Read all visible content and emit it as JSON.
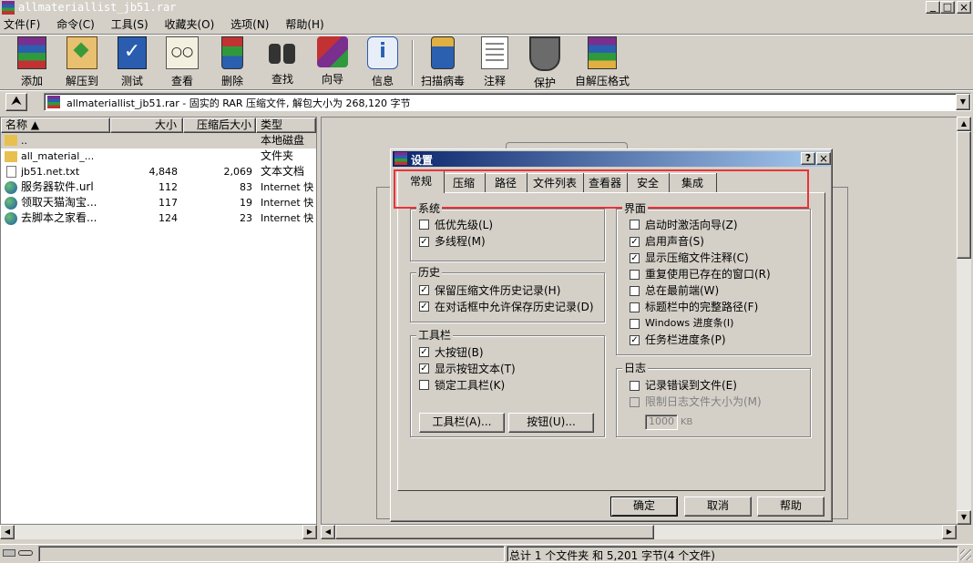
{
  "window": {
    "title": "allmateriallist_jb51.rar"
  },
  "menu": [
    "文件(F)",
    "命令(C)",
    "工具(S)",
    "收藏夹(O)",
    "选项(N)",
    "帮助(H)"
  ],
  "toolbar": [
    {
      "label": "添加",
      "icon": "add-icon"
    },
    {
      "label": "解压到",
      "icon": "extract-icon"
    },
    {
      "label": "测试",
      "icon": "test-icon"
    },
    {
      "label": "查看",
      "icon": "view-icon"
    },
    {
      "label": "删除",
      "icon": "delete-icon"
    },
    {
      "label": "查找",
      "icon": "find-icon"
    },
    {
      "label": "向导",
      "icon": "wizard-icon"
    },
    {
      "label": "信息",
      "icon": "info-icon"
    },
    {
      "label": "扫描病毒",
      "icon": "virus-scan-icon"
    },
    {
      "label": "注释",
      "icon": "comment-icon"
    },
    {
      "label": "保护",
      "icon": "protect-icon"
    },
    {
      "label": "自解压格式",
      "icon": "sfx-icon"
    }
  ],
  "address": {
    "text": "allmateriallist_jb51.rar - 固实的 RAR 压缩文件, 解包大小为 268,120 字节"
  },
  "filelist": {
    "columns": [
      "名称 ▲",
      "大小",
      "压缩后大小",
      "类型"
    ],
    "rows": [
      {
        "name": "..",
        "size": "",
        "packed": "",
        "type": "本地磁盘",
        "icon": "folder-up-icon"
      },
      {
        "name": "all_material_...",
        "size": "",
        "packed": "",
        "type": "文件夹",
        "icon": "folder-icon"
      },
      {
        "name": "jb51.net.txt",
        "size": "4,848",
        "packed": "2,069",
        "type": "文本文档",
        "icon": "text-file-icon"
      },
      {
        "name": "服务器软件.url",
        "size": "112",
        "packed": "83",
        "type": "Internet 快",
        "icon": "globe-icon"
      },
      {
        "name": "领取天猫淘宝...",
        "size": "117",
        "packed": "19",
        "type": "Internet 快",
        "icon": "globe-icon"
      },
      {
        "name": "去脚本之家看...",
        "size": "124",
        "packed": "23",
        "type": "Internet 快",
        "icon": "globe-icon"
      }
    ]
  },
  "dialog": {
    "title": "设置",
    "help_q": "?",
    "close": "×",
    "tabs": [
      "常规",
      "压缩",
      "路径",
      "文件列表",
      "查看器",
      "安全",
      "集成"
    ],
    "system": {
      "title": "系统",
      "items": [
        {
          "label": "低优先级(L)",
          "checked": false
        },
        {
          "label": "多线程(M)",
          "checked": true
        }
      ]
    },
    "history": {
      "title": "历史",
      "items": [
        {
          "label": "保留压缩文件历史记录(H)",
          "checked": true
        },
        {
          "label": "在对话框中允许保存历史记录(D)",
          "checked": true
        }
      ]
    },
    "toolbar_group": {
      "title": "工具栏",
      "items": [
        {
          "label": "大按钮(B)",
          "checked": true
        },
        {
          "label": "显示按钮文本(T)",
          "checked": true
        },
        {
          "label": "锁定工具栏(K)",
          "checked": false
        }
      ],
      "btn_toolbar": "工具栏(A)...",
      "btn_buttons": "按钮(U)..."
    },
    "interface": {
      "title": "界面",
      "items": [
        {
          "label": "启动时激活向导(Z)",
          "checked": false
        },
        {
          "label": "启用声音(S)",
          "checked": true
        },
        {
          "label": "显示压缩文件注释(C)",
          "checked": true
        },
        {
          "label": "重复使用已存在的窗口(R)",
          "checked": false
        },
        {
          "label": "总在最前端(W)",
          "checked": false
        },
        {
          "label": "标题栏中的完整路径(F)",
          "checked": false
        },
        {
          "label": "Windows 进度条(I)",
          "checked": false
        },
        {
          "label": "任务栏进度条(P)",
          "checked": true
        }
      ]
    },
    "log": {
      "title": "日志",
      "items": [
        {
          "label": "记录错误到文件(E)",
          "checked": false
        },
        {
          "label": "限制日志文件大小为(M)",
          "checked": false
        }
      ],
      "size_value": "1000",
      "size_unit": "KB"
    },
    "ok": "确定",
    "cancel": "取消",
    "help": "帮助"
  },
  "status": {
    "text": "总计 1 个文件夹 和 5,201 字节(4 个文件)"
  },
  "colors": {
    "titlebar_inactive": "#808080",
    "dialog_title": "#0a246a",
    "highlight": "#e8333a"
  }
}
